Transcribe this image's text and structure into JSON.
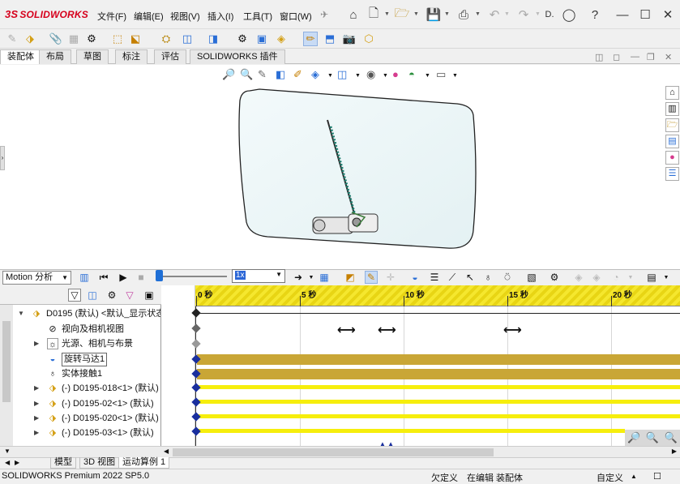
{
  "app": {
    "logo_ds": "3S",
    "logo_text": "SOLIDWORKS"
  },
  "menu": [
    {
      "label": "文件(F)"
    },
    {
      "label": "编辑(E)"
    },
    {
      "label": "视图(V)"
    },
    {
      "label": "插入(I)"
    },
    {
      "label": "工具(T)"
    },
    {
      "label": "窗口(W)"
    }
  ],
  "title_ellipsis": "D.",
  "command_tabs": [
    "装配体",
    "布局",
    "草图",
    "标注",
    "评估",
    "SOLIDWORKS 插件"
  ],
  "motion": {
    "study_type": "Motion 分析",
    "speed": "1x"
  },
  "timeline": {
    "ticks": [
      "0 秒",
      "5 秒",
      "10 秒",
      "15 秒",
      "20 秒"
    ]
  },
  "tree": {
    "root": "D0195 (默认) <默认_显示状态",
    "items": [
      {
        "label": "视向及相机视图",
        "icon": "camera-icon"
      },
      {
        "label": "光源、相机与布景",
        "icon": "lights-icon"
      },
      {
        "label": "旋转马达1",
        "icon": "motor-icon"
      },
      {
        "label": "实体接触1",
        "icon": "contact-icon"
      },
      {
        "label": "(-) D0195-018<1> (默认)",
        "icon": "part-icon"
      },
      {
        "label": "(-) D0195-02<1> (默认)",
        "icon": "part-icon"
      },
      {
        "label": "(-) D0195-020<1> (默认)",
        "icon": "part-icon"
      },
      {
        "label": "(-) D0195-03<1> (默认)",
        "icon": "part-icon"
      }
    ]
  },
  "bottom_tabs": [
    "模型",
    "3D 视图",
    "运动算例 1"
  ],
  "status": {
    "version": "SOLIDWORKS Premium 2022 SP5.0",
    "undefined": "欠定义",
    "editing": "在编辑 装配体",
    "custom": "自定义"
  },
  "colors": {
    "accent": "#d6001c",
    "timeline_ruler": "#f5e72e",
    "gold_bar": "#c9a636",
    "yellow_bar": "#f6ee0c",
    "key_blue": "#1a2f9e"
  }
}
